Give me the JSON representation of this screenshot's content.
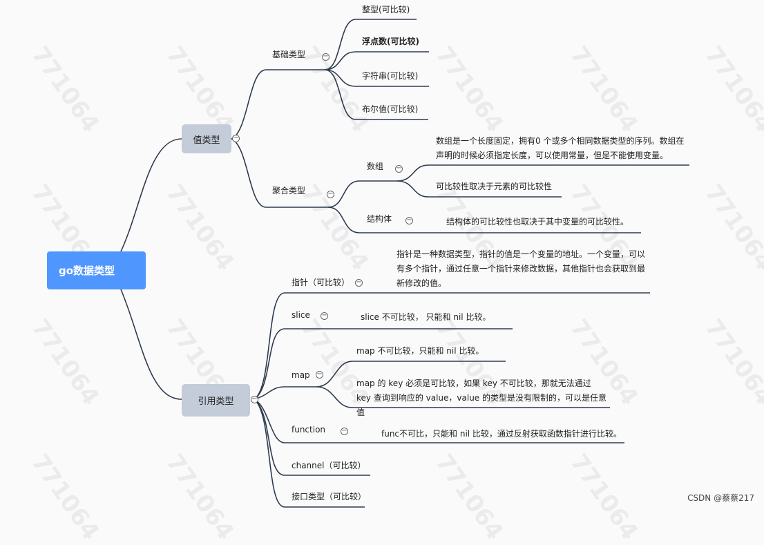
{
  "root": "go数据类型",
  "value_types": {
    "label": "值类型",
    "basic": {
      "label": "基础类型",
      "items": [
        "整型(可比较)",
        "浮点数(可比较)",
        "字符串(可比较)",
        "布尔值(可比较)"
      ]
    },
    "aggregate": {
      "label": "聚合类型",
      "array": {
        "label": "数组",
        "notes": [
          "数组是一个长度固定，拥有0 个或多个相同数据类型的序列。数组在声明的时候必须指定长度，可以使用常量，但是不能使用变量。",
          "可比较性取决于元素的可比较性"
        ]
      },
      "struct": {
        "label": "结构体",
        "note": "结构体的可比较性也取决于其中变量的可比较性。"
      }
    }
  },
  "ref_types": {
    "label": "引用类型",
    "pointer": {
      "label": "指针（可比较）",
      "note": "指针是一种数据类型，指针的值是一个变量的地址。一个变量，可以有多个指针，通过任意一个指针来修改数据，其他指针也会获取到最新修改的值。"
    },
    "slice": {
      "label": "slice",
      "note": "slice 不可比较， 只能和 nil 比较。"
    },
    "map": {
      "label": "map",
      "notes": [
        "map 不可比较，只能和 nil 比较。",
        "map 的 key 必须是可比较，如果 key 不可比较，那就无法通过 key 查询到响应的 value，value 的类型是没有限制的，可以是任意值"
      ]
    },
    "function": {
      "label": "function",
      "note": "func不可比，只能和 nil 比较，通过反射获取函数指针进行比较。"
    },
    "channel": {
      "label": "channel（可比较）"
    },
    "interface": {
      "label": "接口类型（可比较）"
    }
  },
  "watermark": "771064",
  "footer": "CSDN @蔡蔡217",
  "colors": {
    "root": "#4f97ff",
    "level1": "#c3ccd8",
    "line": "#2e3a4f"
  }
}
